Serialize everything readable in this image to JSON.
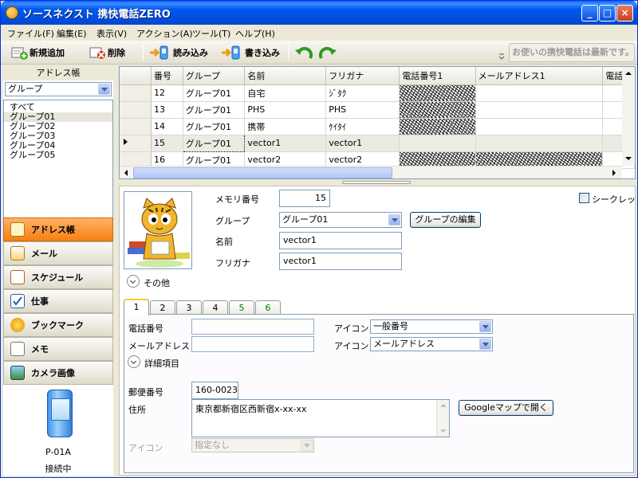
{
  "window": {
    "title": "ソースネクスト 携快電話ZERO",
    "minimize": "_",
    "maximize": "□",
    "close": "×"
  },
  "menu": [
    "ファイル(F)",
    "編集(E)",
    "表示(V)",
    "アクション(A)",
    "ツール(T)",
    "ヘルプ(H)"
  ],
  "toolbar": {
    "new": "新規追加",
    "delete": "削除",
    "read": "読み込み",
    "write": "書き込み",
    "notice": "お使いの携快電話は最新です。"
  },
  "sidebar": {
    "title": "アドレス帳",
    "group_select": "グループ",
    "groups": [
      "すべて",
      "グループ01",
      "グループ02",
      "グループ03",
      "グループ04",
      "グループ05"
    ],
    "selected_group": "グループ01",
    "nav": [
      "アドレス帳",
      "メール",
      "スケジュール",
      "仕事",
      "ブックマーク",
      "メモ",
      "カメラ画像"
    ],
    "active_nav": "アドレス帳",
    "device_model": "P-01A",
    "status": "接続中"
  },
  "grid": {
    "columns": [
      "番号",
      "グループ",
      "名前",
      "フリガナ",
      "電話番号1",
      "メールアドレス1",
      "電話"
    ],
    "rows": [
      {
        "no": "12",
        "group": "グループ01",
        "name": "自宅",
        "kana": "ｼﾞﾀｸ"
      },
      {
        "no": "13",
        "group": "グループ01",
        "name": "PHS",
        "kana": "PHS"
      },
      {
        "no": "14",
        "group": "グループ01",
        "name": "携帯",
        "kana": "ｹｲﾀｲ"
      },
      {
        "no": "15",
        "group": "グループ01",
        "name": "vector1",
        "kana": "vector1"
      },
      {
        "no": "16",
        "group": "グループ01",
        "name": "vector2",
        "kana": "vector2"
      }
    ],
    "selected_row": 3
  },
  "detail": {
    "memory_label": "メモリ番号",
    "memory_value": "15",
    "secret_label": "シークレット",
    "group_label": "グループ",
    "group_value": "グループ01",
    "edit_group_button": "グループの編集",
    "name_label": "名前",
    "name_value": "vector1",
    "kana_label": "フリガナ",
    "kana_value": "vector1",
    "other_label": "その他",
    "tabs": [
      "1",
      "2",
      "3",
      "4",
      "5",
      "6"
    ],
    "phone_label": "電話番号",
    "icon_label": "アイコン",
    "phone_icon": "一般番号",
    "mail_label": "メールアドレス",
    "mail_icon": "メールアドレス",
    "details_label": "詳細項目",
    "zip_label": "郵便番号",
    "zip_value": "160-0023",
    "address_label": "住所",
    "address_value": "東京都新宿区西新宿x-xx-xx",
    "map_button": "Googleマップで開く",
    "icon2_label": "アイコン",
    "icon2_value": "指定なし"
  }
}
